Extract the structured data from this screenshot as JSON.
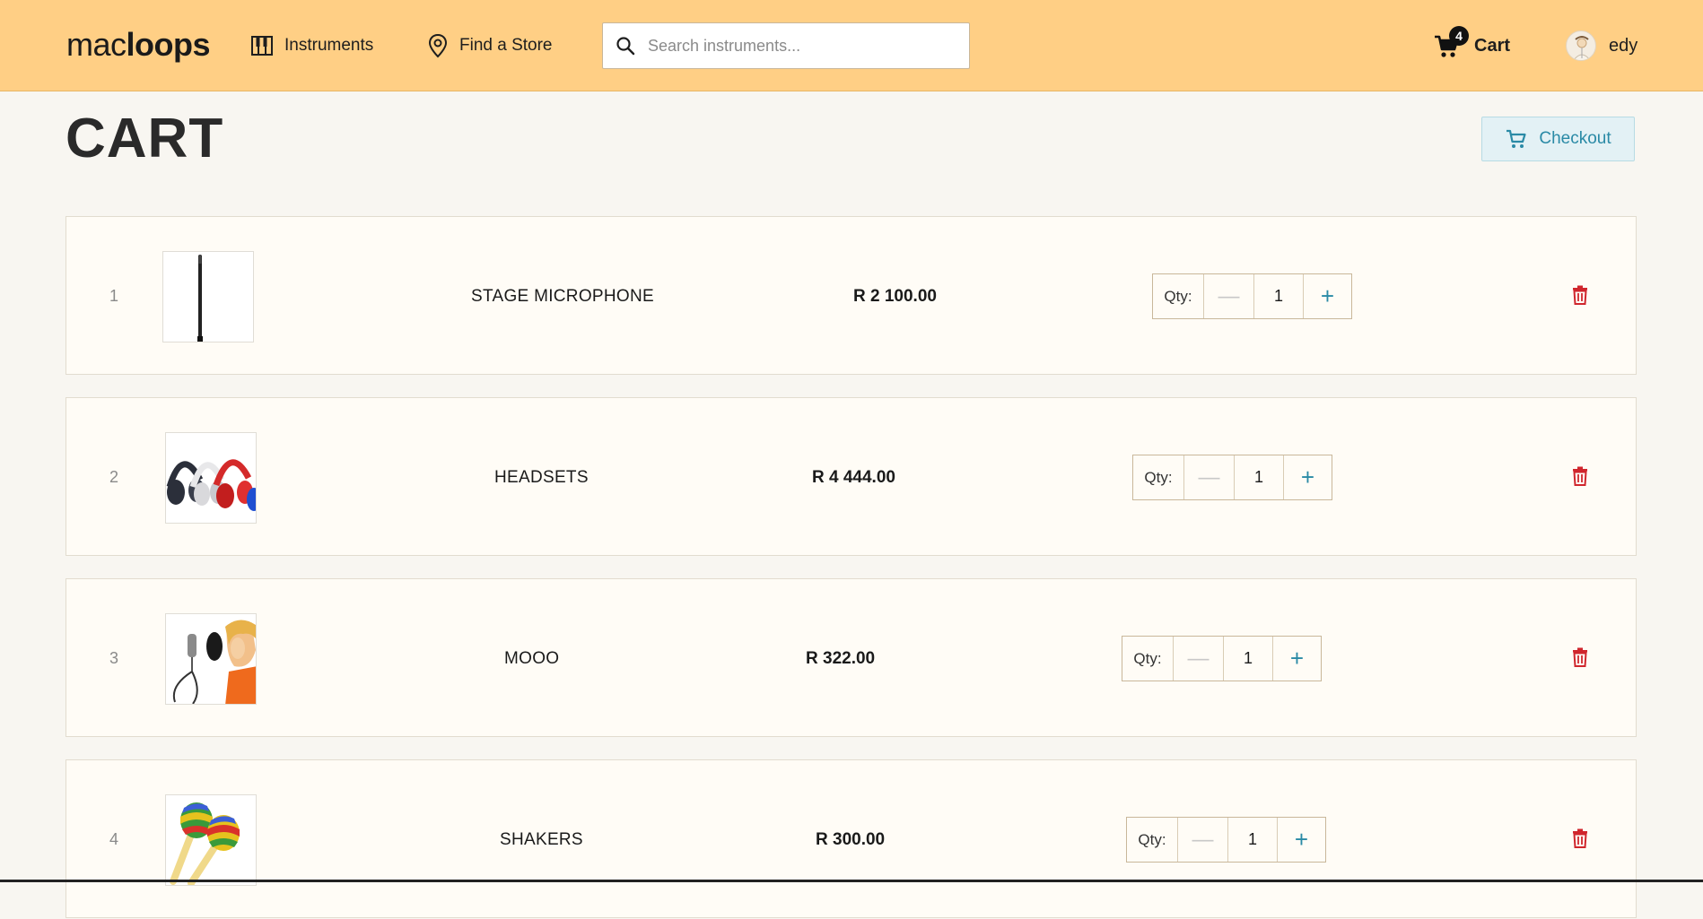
{
  "header": {
    "logo_regular": "mac",
    "logo_bold": "loops",
    "nav": {
      "instruments": "Instruments",
      "find_store": "Find a Store"
    },
    "search": {
      "placeholder": "Search instruments..."
    },
    "cart": {
      "label": "Cart",
      "count": "4"
    },
    "user": {
      "name": "edy"
    },
    "colors": {
      "background": "#ffcf85",
      "accent": "#2a8aa6"
    }
  },
  "page": {
    "title": "CART",
    "checkout_label": "Checkout"
  },
  "cart_items": [
    {
      "index": "1",
      "name": "STAGE MICROPHONE",
      "price": "R 2 100.00",
      "qty_label": "Qty:",
      "qty": "1",
      "minus": "—",
      "plus": "+",
      "image": "mic-stand"
    },
    {
      "index": "2",
      "name": "HEADSETS",
      "price": "R 4 444.00",
      "qty_label": "Qty:",
      "qty": "1",
      "minus": "—",
      "plus": "+",
      "image": "headphones"
    },
    {
      "index": "3",
      "name": "MOOO",
      "price": "R 322.00",
      "qty_label": "Qty:",
      "qty": "1",
      "minus": "—",
      "plus": "+",
      "image": "studio-mic-singer"
    },
    {
      "index": "4",
      "name": "SHAKERS",
      "price": "R 300.00",
      "qty_label": "Qty:",
      "qty": "1",
      "minus": "—",
      "plus": "+",
      "image": "maracas"
    }
  ],
  "colors": {
    "delete": "#d0262d",
    "row_background": "#fffcf6",
    "page_background": "#f8f6f1"
  }
}
